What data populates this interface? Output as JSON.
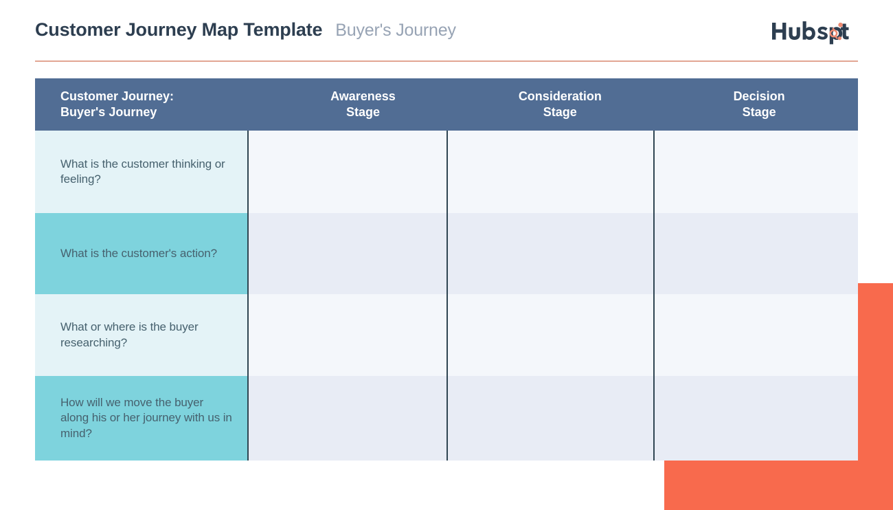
{
  "header": {
    "title": "Customer Journey Map Template",
    "subtitle": "Buyer's Journey",
    "brand": "HubSpot",
    "logo_icon": "hubspot-logo",
    "rule_color": "#e2a593"
  },
  "colors": {
    "header_row": "#516d94",
    "label_light": "#e4f3f7",
    "label_teal": "#7ed3dd",
    "cell_light": "#f4f7fb",
    "cell_alt": "#e8ecf5",
    "divider": "#2f4552",
    "accent_orange": "#f86a4d",
    "title": "#2d3e50",
    "subtitle": "#97a3b4",
    "body_text": "#46616e"
  },
  "table": {
    "columns": [
      {
        "line1": "Customer Journey:",
        "line2": "Buyer's Journey"
      },
      {
        "line1": "Awareness",
        "line2": "Stage"
      },
      {
        "line1": "Consideration",
        "line2": "Stage"
      },
      {
        "line1": "Decision",
        "line2": "Stage"
      }
    ],
    "rows": [
      {
        "label": "What is the customer thinking or feeling?",
        "awareness": "",
        "consideration": "",
        "decision": ""
      },
      {
        "label": "What is the customer's action?",
        "awareness": "",
        "consideration": "",
        "decision": ""
      },
      {
        "label": "What or where is the buyer researching?",
        "awareness": "",
        "consideration": "",
        "decision": ""
      },
      {
        "label": "How will we move the buyer along his or her journey with us in mind?",
        "awareness": "",
        "consideration": "",
        "decision": ""
      }
    ]
  },
  "decoration": {
    "shape_name": "orange-corner-shape"
  }
}
